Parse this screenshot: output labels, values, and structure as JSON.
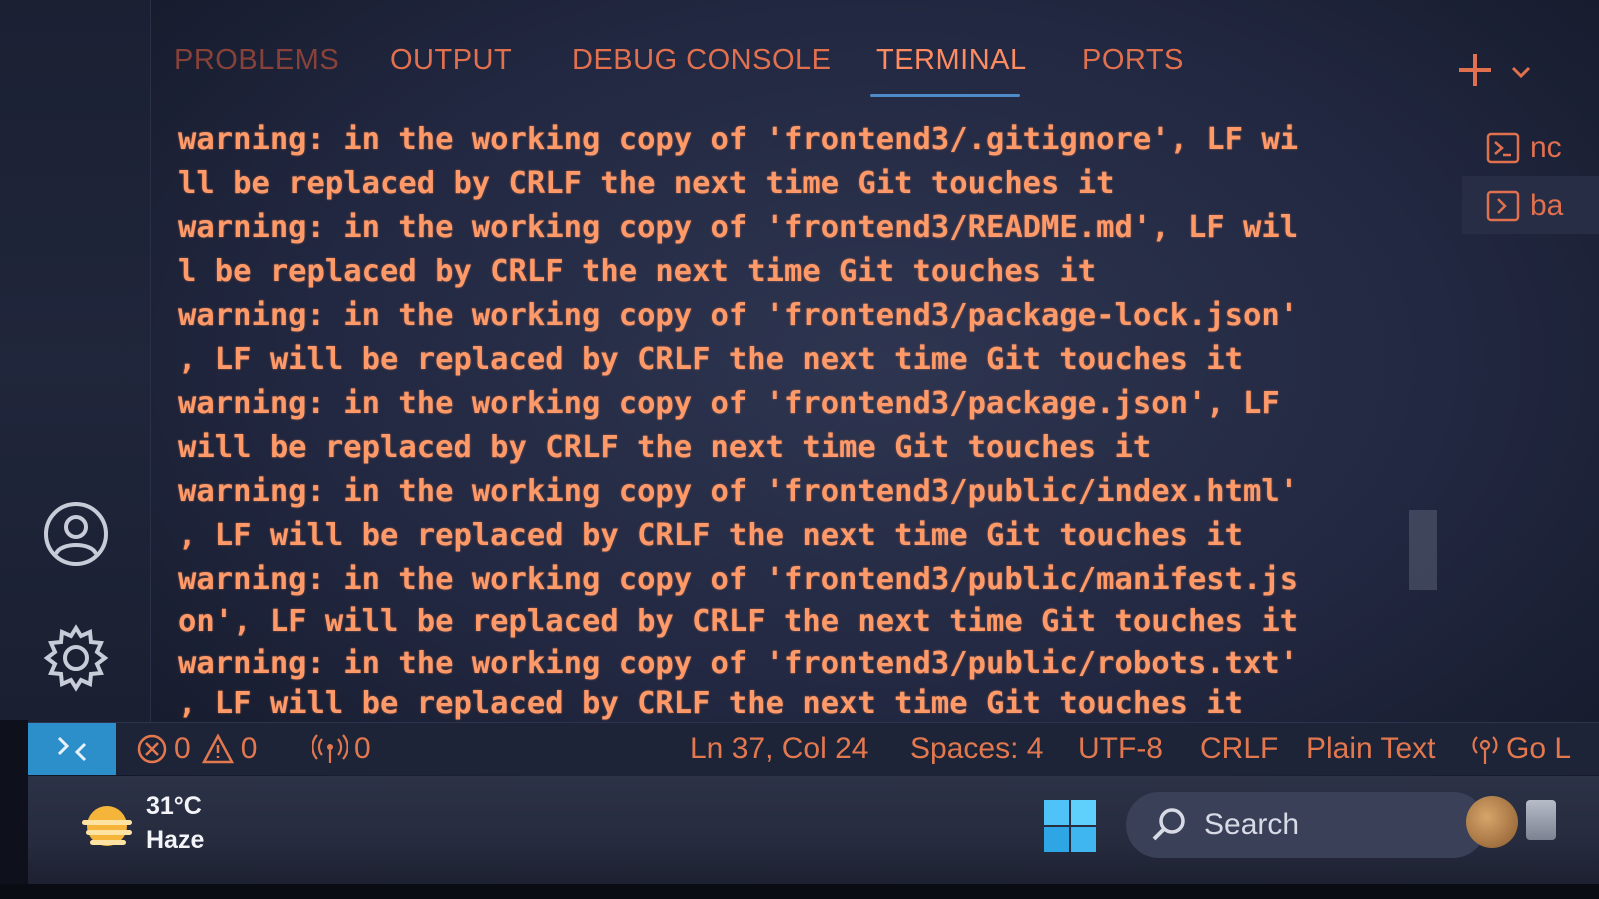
{
  "panel": {
    "tabs": [
      {
        "label": "PROBLEMS"
      },
      {
        "label": "OUTPUT"
      },
      {
        "label": "DEBUG CONSOLE"
      },
      {
        "label": "TERMINAL"
      },
      {
        "label": "PORTS"
      }
    ],
    "active_tab": "TERMINAL"
  },
  "terminal": {
    "lines": [
      "warning: in the working copy of 'frontend3/.gitignore', LF wi",
      "ll be replaced by CRLF the next time Git touches it",
      "warning: in the working copy of 'frontend3/README.md', LF wil",
      "l be replaced by CRLF the next time Git touches it",
      "warning: in the working copy of 'frontend3/package-lock.json'",
      ", LF will be replaced by CRLF the next time Git touches it",
      "warning: in the working copy of 'frontend3/package.json', LF",
      "will be replaced by CRLF the next time Git touches it",
      "warning: in the working copy of 'frontend3/public/index.html'",
      ", LF will be replaced by CRLF the next time Git touches it",
      "warning: in the working copy of 'frontend3/public/manifest.js",
      "on', LF will be replaced by CRLF the next time Git touches it",
      "warning: in the working copy of 'frontend3/public/robots.txt'",
      ", LF will be replaced by CRLF the next time Git touches it"
    ],
    "list": [
      {
        "label": "nc",
        "icon": "terminal-icon"
      },
      {
        "label": "ba",
        "icon": "terminal-icon"
      }
    ]
  },
  "status_bar": {
    "errors": "0",
    "warnings": "0",
    "ports": "0",
    "cursor": "Ln 37, Col 24",
    "spaces": "Spaces: 4",
    "encoding": "UTF-8",
    "eol": "CRLF",
    "language": "Plain Text",
    "golive": "Go L"
  },
  "taskbar": {
    "weather_temp": "31°C",
    "weather_condition": "Haze",
    "search_label": "Search"
  },
  "colors": {
    "terminal_text": "#ff9a68",
    "tab_text": "#e1704f",
    "active_tab_underline": "#4e8cc9",
    "remote_button": "#2d8fc9"
  }
}
